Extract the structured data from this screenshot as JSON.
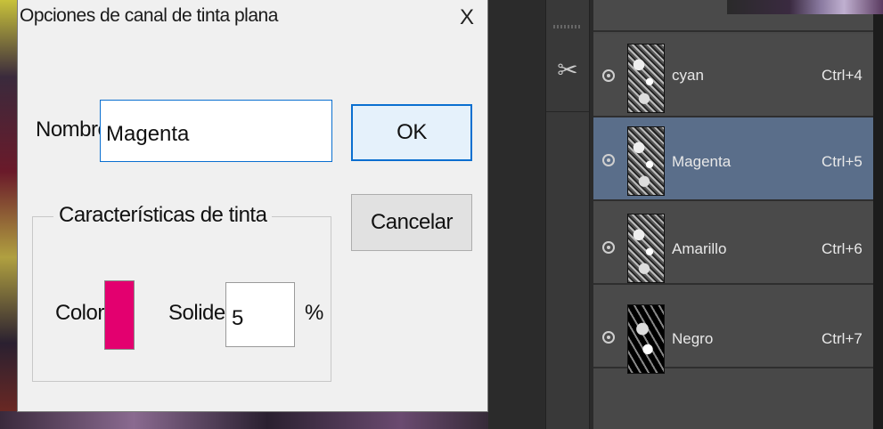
{
  "dialog": {
    "title": "Opciones de canal de tinta plana",
    "close_label": "X",
    "name_label": "Nombre:",
    "name_value": "Magenta",
    "ok_label": "OK",
    "cancel_label": "Cancelar",
    "group_title": "Características de tinta",
    "color_label": "Color:",
    "color_value": "#e3006f",
    "solidity_label": "Solidez:",
    "solidity_value": "5",
    "percent_label": "%"
  },
  "channels": {
    "items": [
      {
        "name": "cyan",
        "shortcut": "Ctrl+4",
        "selected": false
      },
      {
        "name": "Magenta",
        "shortcut": "Ctrl+5",
        "selected": true
      },
      {
        "name": "Amarillo",
        "shortcut": "Ctrl+6",
        "selected": false
      },
      {
        "name": "Negro",
        "shortcut": "Ctrl+7",
        "selected": false
      }
    ]
  },
  "toolbar": {
    "tool_icon": "scissors-icon"
  },
  "colors": {
    "selected_row": "#5a6e8a",
    "accent": "#0a6fd0",
    "ink": "#e3006f"
  }
}
